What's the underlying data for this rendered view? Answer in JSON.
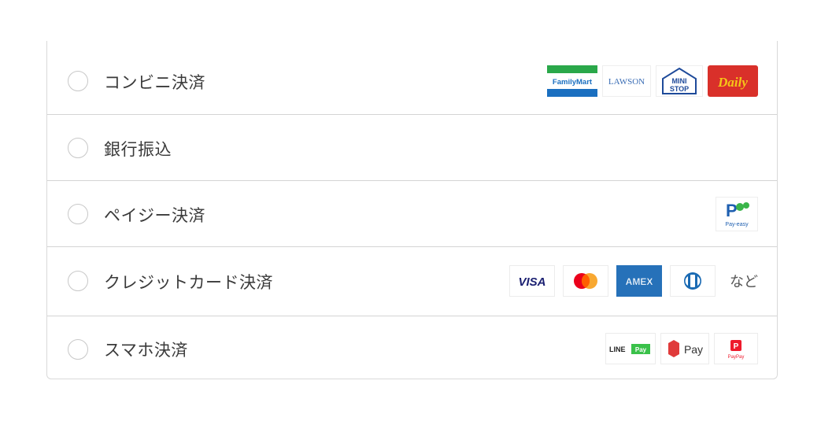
{
  "payment_methods": [
    {
      "label": "コンビニ決済",
      "logos": [
        "FamilyMart",
        "LAWSON",
        "MINI STOP",
        "Daily"
      ]
    },
    {
      "label": "銀行振込",
      "logos": []
    },
    {
      "label": "ペイジー決済",
      "logos": [
        "Pay-easy"
      ]
    },
    {
      "label": "クレジットカード決済",
      "logos": [
        "VISA",
        "mastercard-icon",
        "AMEX",
        "diners-icon"
      ],
      "suffix": "など"
    },
    {
      "label": "スマホ決済",
      "logos": [
        "LINE Pay",
        "Pay",
        "PayPay"
      ]
    }
  ],
  "logo_text": {
    "familymart": "FamilyMart",
    "lawson": "LAWSON",
    "ministop_top": "MINI",
    "ministop_bottom": "STOP",
    "daily": "Daily",
    "payeasy": "Pay-easy",
    "visa": "VISA",
    "amex": "AMEX",
    "linepay_line": "LINE",
    "linepay_pay": "Pay",
    "merpay": "Pay",
    "paypay": "PayPay"
  },
  "colors": {
    "familymart_green": "#2aa84a",
    "familymart_blue": "#1a6fc0",
    "lawson_blue": "#3a6db5",
    "daily_red": "#d9302a",
    "daily_yellow": "#f5c518",
    "visa_navy": "#1a1f71",
    "amex_blue": "#2671b9",
    "line_green": "#3ac14a",
    "merpay_red": "#e03a3a",
    "paypay_red": "#ee1a2c"
  }
}
